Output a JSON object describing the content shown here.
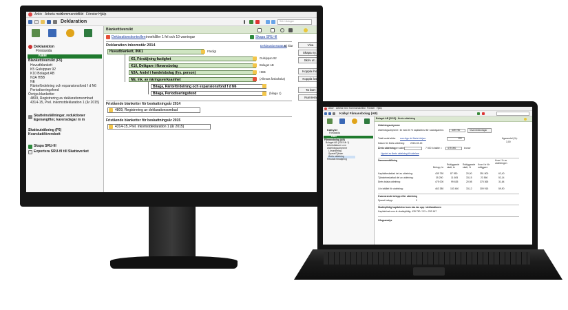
{
  "desktop": {
    "menu": [
      "Arkiv",
      "Arbeta med",
      "Kommando",
      "Bild",
      "Fönster",
      "Hjälp"
    ],
    "toolbar_title": "Deklaration",
    "search_placeholder": "Sök i dialogen",
    "sidebar": {
      "title": "Deklaration",
      "subtitle": "Förstasida",
      "section_a": "Kalle",
      "overview_label": "Blankettöversikt (F5)",
      "items": [
        "Huvudblankett",
        "K5 Gulsippan 92",
        "K10 Bolaget AB",
        "N3A HBB",
        "NE",
        "Räntefördelning och expansionsfond f d N6",
        "Periodiseringsfond"
      ],
      "other_label": "Övriga blanketter",
      "other_items": [
        "4809, Registrering av deklarationsombud",
        "4314-15, Prel. inkomstdeklaration 1 (år 2015)"
      ],
      "group1_line1": "Skatteinställningar, reduktioner",
      "group1_line2": "Egenavgifter, karensdagar m m",
      "group2_line1": "Skatteuträkning (F6)",
      "group2_line2": "Kvarskatt/överskott",
      "sru_label": "Skapa SRU-fil",
      "export_label": "Exportera SRU-fil till Skatteverket"
    },
    "header_title": "Blankettöversikt",
    "content": {
      "check_link": "Deklarationskontrollen",
      "check_text": "innehåller 1 fel och 10 varningar",
      "sru_link": "Skapa SRU-fil",
      "section_title": "Deklaration inkomstår 2014",
      "status_link": "Deklarationsstatus:",
      "status_value": "Ej klar",
      "main_form": "Huvudblankett, INK1",
      "main_note": "Färdigt",
      "forms": [
        {
          "label": "K5, Försäljning fastighet",
          "note": "Gulsippan 92"
        },
        {
          "label": "K10, Delägare i fåmansbolag",
          "note": "Bolaget AB"
        },
        {
          "label": "N3A, Andel i handelsbolag (fys. person)",
          "note": "HBB"
        },
        {
          "label": "NE, Ink. av näringsverksamhet",
          "note": "(Allmänt årsbokslut)"
        }
      ],
      "attachments": [
        {
          "label": "Bilaga, Räntefördelning och expansionsfond f d N6",
          "note": ""
        },
        {
          "label": "Bilaga, Periodiseringsfond",
          "note": "(bilaga 1)"
        }
      ],
      "free2014_title": "Fristående blanketter för beskattningsår 2014",
      "free2014_item": "4809, Registrering av deklarationsombud",
      "free2015_title": "Fristående blanketter för beskattningsår 2015",
      "free2015_item": "4314-15, Prel. inkomstdeklaration 1 (år 2015)",
      "buttons": [
        "Visa",
        "Skapa ny...",
        "Skriv ut...",
        "Koppla ihop",
        "Koppla loss",
        "Ta bort",
        "Numrera"
      ]
    }
  },
  "laptop": {
    "menu": [
      "Arkiv",
      "Arbeta med",
      "Kommando",
      "Bild",
      "Fönster",
      "Hjälp"
    ],
    "toolbar_title": "Kalkyl Fåmansbolag (AB)",
    "header_title": "Bolaget AB [2015] - Årets utdelning",
    "sidebar_title": "Kalkyler",
    "sidebar_subtitle": "Förstasida",
    "sidebar_items": [
      "Kalle",
      "Fåmansbolag (AB)",
      "Bolaget AB (2015 år 1)",
      "Arbetsfakturer a m",
      "Utdelningsutrymme",
      "Lönunderlag",
      "Sparat/Tjänan",
      "Årets utdelning",
      "Resultat försäljning"
    ],
    "util_title": "Utdelningsutrymme",
    "util_text": "Utdelningsutrymme i år med 20 % kapitalvinst för rundragarens:",
    "util_value": "439 750",
    "util_button": "Visa beräkningar",
    "shares_text": "Totalt antal aktier",
    "shares_mid": "som ägs vid årets början:",
    "shares_value": "100",
    "ownership_label": "Ägarandel (%):",
    "ownership_value": "3,00",
    "date_label": "Datum för årets utdelning:",
    "date_value": "2015-03-15",
    "dividend_label": "Årets utdelning",
    "dividend_per": "per aktie:",
    "dividend_value": "7 500",
    "dividend_unit": "kr/aktie =",
    "dividend_total": "475 000",
    "dividend_total_unit": "kronor",
    "link_text": "Uppdel av årets utdelning till utdelare",
    "summary_title": "Sammanställning",
    "summary_headers": [
      "Belopp, kr",
      "Ruttiggande skatt, kr",
      "Ruttiggande skatt, %",
      "Kvar i kr för ruttiggare",
      "Kvar i % av utdelningen"
    ],
    "summary_rows": [
      {
        "label": "Kapitalbeskattad del av utdelning:",
        "values": [
          "439 750",
          "87 950",
          "20,00",
          "351 800",
          "62,40"
        ]
      },
      {
        "label": "Tjänstebeskattad del av utdelning:",
        "values": [
          "35 250",
          "11 605",
          "33,15",
          "23 560",
          "52,14"
        ]
      },
      {
        "label": "Årets totala utdelning:",
        "values": [
          "475 000",
          "99 635",
          "20,98",
          "375 365",
          "31,64"
        ]
      }
    ],
    "salary_row": {
      "label": "Lön istället för utdelning:",
      "values": [
        "463 380",
        "153 460",
        "33,12",
        "309 915",
        "59,90"
      ]
    },
    "remaining_title": "Kvarvarande belopp efter utdelning",
    "remaining_label": "Sparat belopp:",
    "remaining_value": "0",
    "taxable_title": "Skattepliktig kapitalvinst som ska tas upp i deklarationen",
    "taxable_text": "Kapitalvinst som är skattepliktig: 439 750 / 2/3 = 293 167",
    "other_title": "Ofogsanalys"
  },
  "colors": {
    "accent_green": "#cfe5c2",
    "header_green": "#dce8d2",
    "warning": "#f3c64a",
    "error": "#e55039"
  }
}
